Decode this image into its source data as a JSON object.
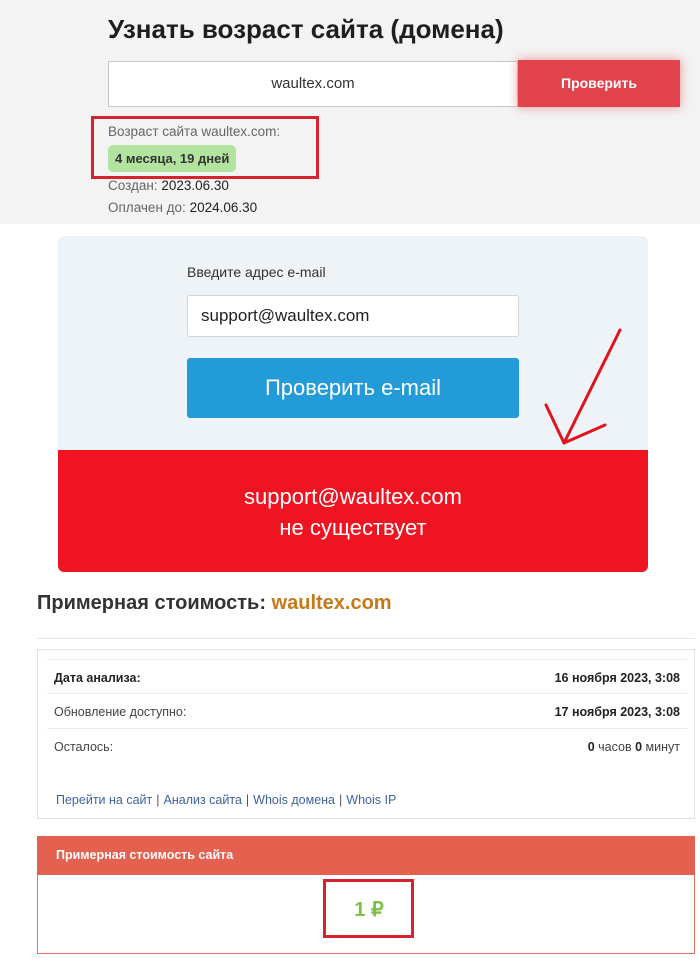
{
  "domain_check": {
    "title": "Узнать возраст сайта (домена)",
    "input_value": "waultex.com",
    "button_label": "Проверить",
    "age_label": "Возраст сайта waultex.com:",
    "age_value": "4 месяца, 19 дней",
    "created_label": "Создан:",
    "created_value": "2023.06.30",
    "paid_label": "Оплачен до:",
    "paid_value": "2024.06.30"
  },
  "email_check": {
    "label": "Введите адрес e-mail",
    "input_value": "support@waultex.com",
    "button_label": "Проверить e-mail",
    "result_line1": "support@waultex.com",
    "result_line2": "не существует"
  },
  "valuation": {
    "title_prefix": "Примерная стоимость:",
    "title_domain": "waultex.com",
    "rows": [
      {
        "label": "Дата анализа:",
        "value": "16 ноября 2023, 3:08"
      },
      {
        "label": "Обновление доступно:",
        "value": "17 ноября 2023, 3:08"
      }
    ],
    "remaining": {
      "label": "Осталось:",
      "hours": "0",
      "hours_unit": "часов",
      "minutes": "0",
      "minutes_unit": "минут"
    },
    "links": [
      "Перейти на сайт",
      "Анализ сайта",
      "Whois домена",
      "Whois IP"
    ],
    "cost_header": "Примерная стоимость сайта",
    "cost_value": "1 ₽"
  },
  "colors": {
    "accent_red": "#e0434c",
    "email_button": "#249bd9",
    "error_panel": "#ee1422",
    "domain_highlight": "#c47a1b",
    "cost_header": "#e4614f",
    "cost_value": "#7cc04a",
    "age_badge": "#b2e4a0"
  }
}
